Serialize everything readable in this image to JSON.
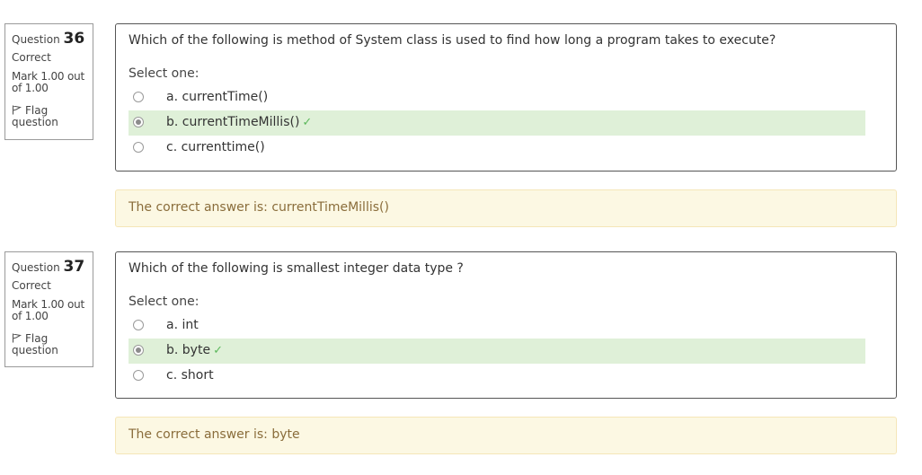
{
  "questions": [
    {
      "label": "Question",
      "number": "36",
      "state": "Correct",
      "grade": "Mark 1.00 out of 1.00",
      "flag": "Flag question",
      "text": "Which of the following is method of System class is used to find how long a program takes to execute?",
      "prompt": "Select one:",
      "options": [
        {
          "label": "a. currentTime()",
          "checked": false,
          "correct": false
        },
        {
          "label": "b. currentTimeMillis()",
          "checked": true,
          "correct": true
        },
        {
          "label": "c. currenttime()",
          "checked": false,
          "correct": false
        }
      ],
      "feedback": "The correct answer is: currentTimeMillis()"
    },
    {
      "label": "Question",
      "number": "37",
      "state": "Correct",
      "grade": "Mark 1.00 out of 1.00",
      "flag": "Flag question",
      "text": "Which of the following is smallest integer data type ?",
      "prompt": "Select one:",
      "options": [
        {
          "label": "a. int",
          "checked": false,
          "correct": false
        },
        {
          "label": "b. byte",
          "checked": true,
          "correct": true
        },
        {
          "label": "c. short",
          "checked": false,
          "correct": false
        }
      ],
      "feedback": "The correct answer is: byte"
    }
  ],
  "icons": {
    "flag": "flag-icon",
    "check": "check-icon",
    "check_glyph": "✓"
  },
  "colors": {
    "correct_bg": "#dff0d8",
    "check": "#5cb85c",
    "feedback_bg": "#fcf8e3",
    "feedback_text": "#8a6d3b"
  }
}
